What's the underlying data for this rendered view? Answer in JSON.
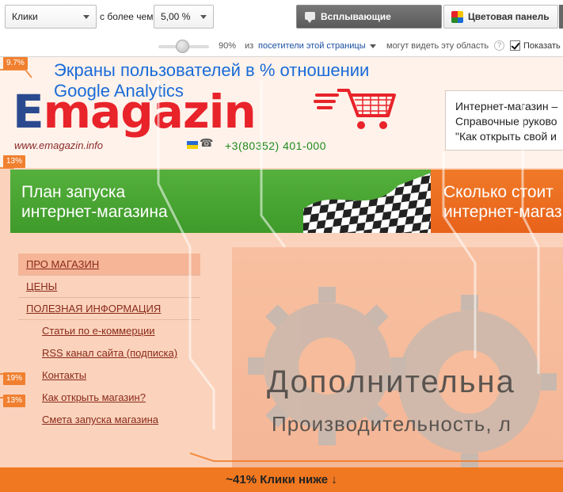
{
  "toolbar": {
    "metric": "Клики",
    "more_than_label": "с более чем:",
    "threshold": "5,00 %",
    "tooltips_button": "Всплывающие подсказки",
    "colorbar_button": "Цветовая панель",
    "slider_value": "90%",
    "from_label": "из",
    "visitors_link": "посетители этой страницы",
    "can_see_label": "могут видеть эту область",
    "help_glyph": "?",
    "show_label": "Показать",
    "show_checked": true
  },
  "overlay_title": "Экраны пользователей в % отношении Google Analytics",
  "site": {
    "logo_e": "E",
    "logo_rest": "magazin",
    "url": "www.emagazin.info",
    "phone": "+3(80352) 401-000",
    "info_lines": [
      "Интернет-магазин –",
      "Справочные руково",
      "\"Как открыть свой и"
    ],
    "banner_green": [
      "План запуска",
      "интернет-магазина"
    ],
    "banner_orange": [
      "Сколько стоит",
      "интернет-магаз"
    ],
    "nav_top": [
      "ПРО МАГАЗИН",
      "ЦЕНЫ",
      "ПОЛЕЗНАЯ ИНФОРМАЦИЯ"
    ],
    "nav_sub": [
      "Статьи по е-коммерции",
      "RSS канал сайта (подписка)",
      "Контакты",
      "Как открыть магазин?",
      "Смета запуска магазина"
    ],
    "hero_title": "Дополнительна",
    "hero_sub": "Производительность, л"
  },
  "badges": [
    "9.7%",
    "13%",
    "19%",
    "13%"
  ],
  "bottom_bar": "~41% Клики ниже ↓",
  "colors": {
    "accent_orange": "#f07820",
    "logo_blue": "#2a4a8f",
    "logo_red": "#e8232a",
    "overlay_blue": "#1a6bd8",
    "phone_green": "#1e8a1e"
  }
}
